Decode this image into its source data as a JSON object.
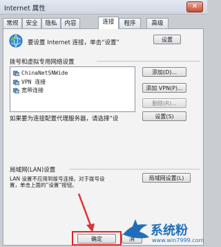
{
  "window": {
    "title": "Internet 属性",
    "close_glyph": "✕"
  },
  "tabs": [
    "常规",
    "安全",
    "隐私",
    "内容",
    "连接",
    "程序",
    "高级"
  ],
  "active_tab": "连接",
  "setup": {
    "text": "要设置 Internet 连接，单击“设置”",
    "button": "设置"
  },
  "dialup": {
    "heading": "拨号和虚拟专用网络设置",
    "connections": [
      "ChinaNetSNWide",
      "VPN 连接",
      "宽带连接"
    ],
    "add_button": "添加(D)...",
    "add_vpn_button": "添加 VPN(P)...",
    "remove_button": "删除(R)...",
    "settings_button": "设置(S)",
    "proxy_text": "如果要为连接配置代理服务器，请选择“设"
  },
  "lan": {
    "heading": "局域网(LAN)设置",
    "desc_line1": "LAN 设置不应用到拨号连接。对于拨号设",
    "desc_line2": "置，单击上面的“设置”按钮。",
    "button": "局域网设置(L)"
  },
  "footer": {
    "ok_button": "确定",
    "extra_button": "消"
  },
  "watermark": {
    "text": "系统粉",
    "url": "www.win7999.com"
  },
  "colors": {
    "callout": "#e02222",
    "arrow": "#d93636",
    "watermark": "#1f6fb8"
  }
}
